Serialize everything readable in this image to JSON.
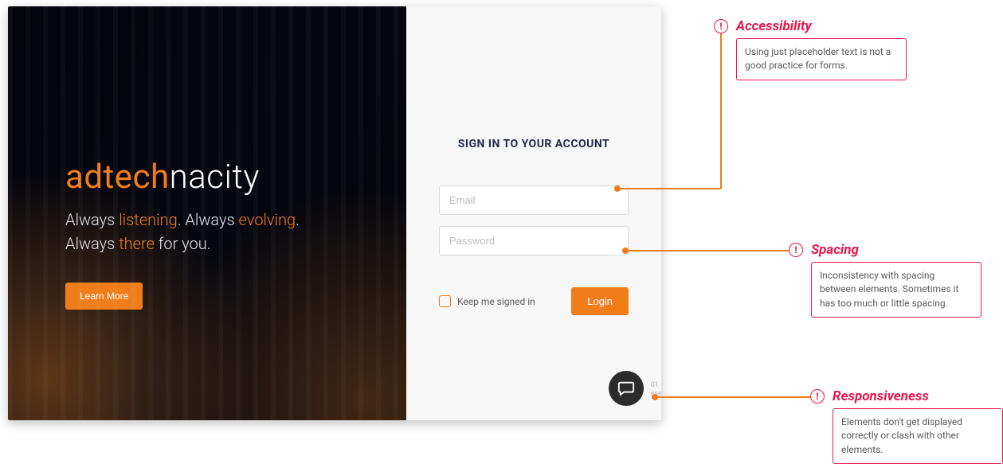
{
  "hero": {
    "logo_part1": "adtech",
    "logo_part2": "nacity",
    "tagline_l1a": "Always ",
    "tagline_l1b": "listening",
    "tagline_l1c": ". Always ",
    "tagline_l1d": "evolving",
    "tagline_l1e": ".",
    "tagline_l2a": "Always ",
    "tagline_l2b": "there",
    "tagline_l2c": " for you.",
    "learn_more": "Learn More"
  },
  "signin": {
    "title": "SIGN IN TO YOUR ACCOUNT",
    "email_placeholder": "Email",
    "password_placeholder": "Password",
    "keep_label": "Keep me signed in",
    "login_label": "Login"
  },
  "corner": {
    "line1": "01",
    "line2": "eser"
  },
  "annotations": {
    "accessibility": {
      "title": "Accessibility",
      "body": "Using just placeholder text is not a good practice for forms.",
      "badge": "!"
    },
    "spacing": {
      "title": "Spacing",
      "body": "Inconsistency with spacing between elements. Sometimes it has too much or little spacing.",
      "badge": "!"
    },
    "responsiveness": {
      "title": "Responsiveness",
      "body": "Elements don't get displayed correctly or clash with other elements.",
      "badge": "!"
    }
  },
  "colors": {
    "accent": "#f07d1a",
    "highlight": "#e8174b"
  }
}
